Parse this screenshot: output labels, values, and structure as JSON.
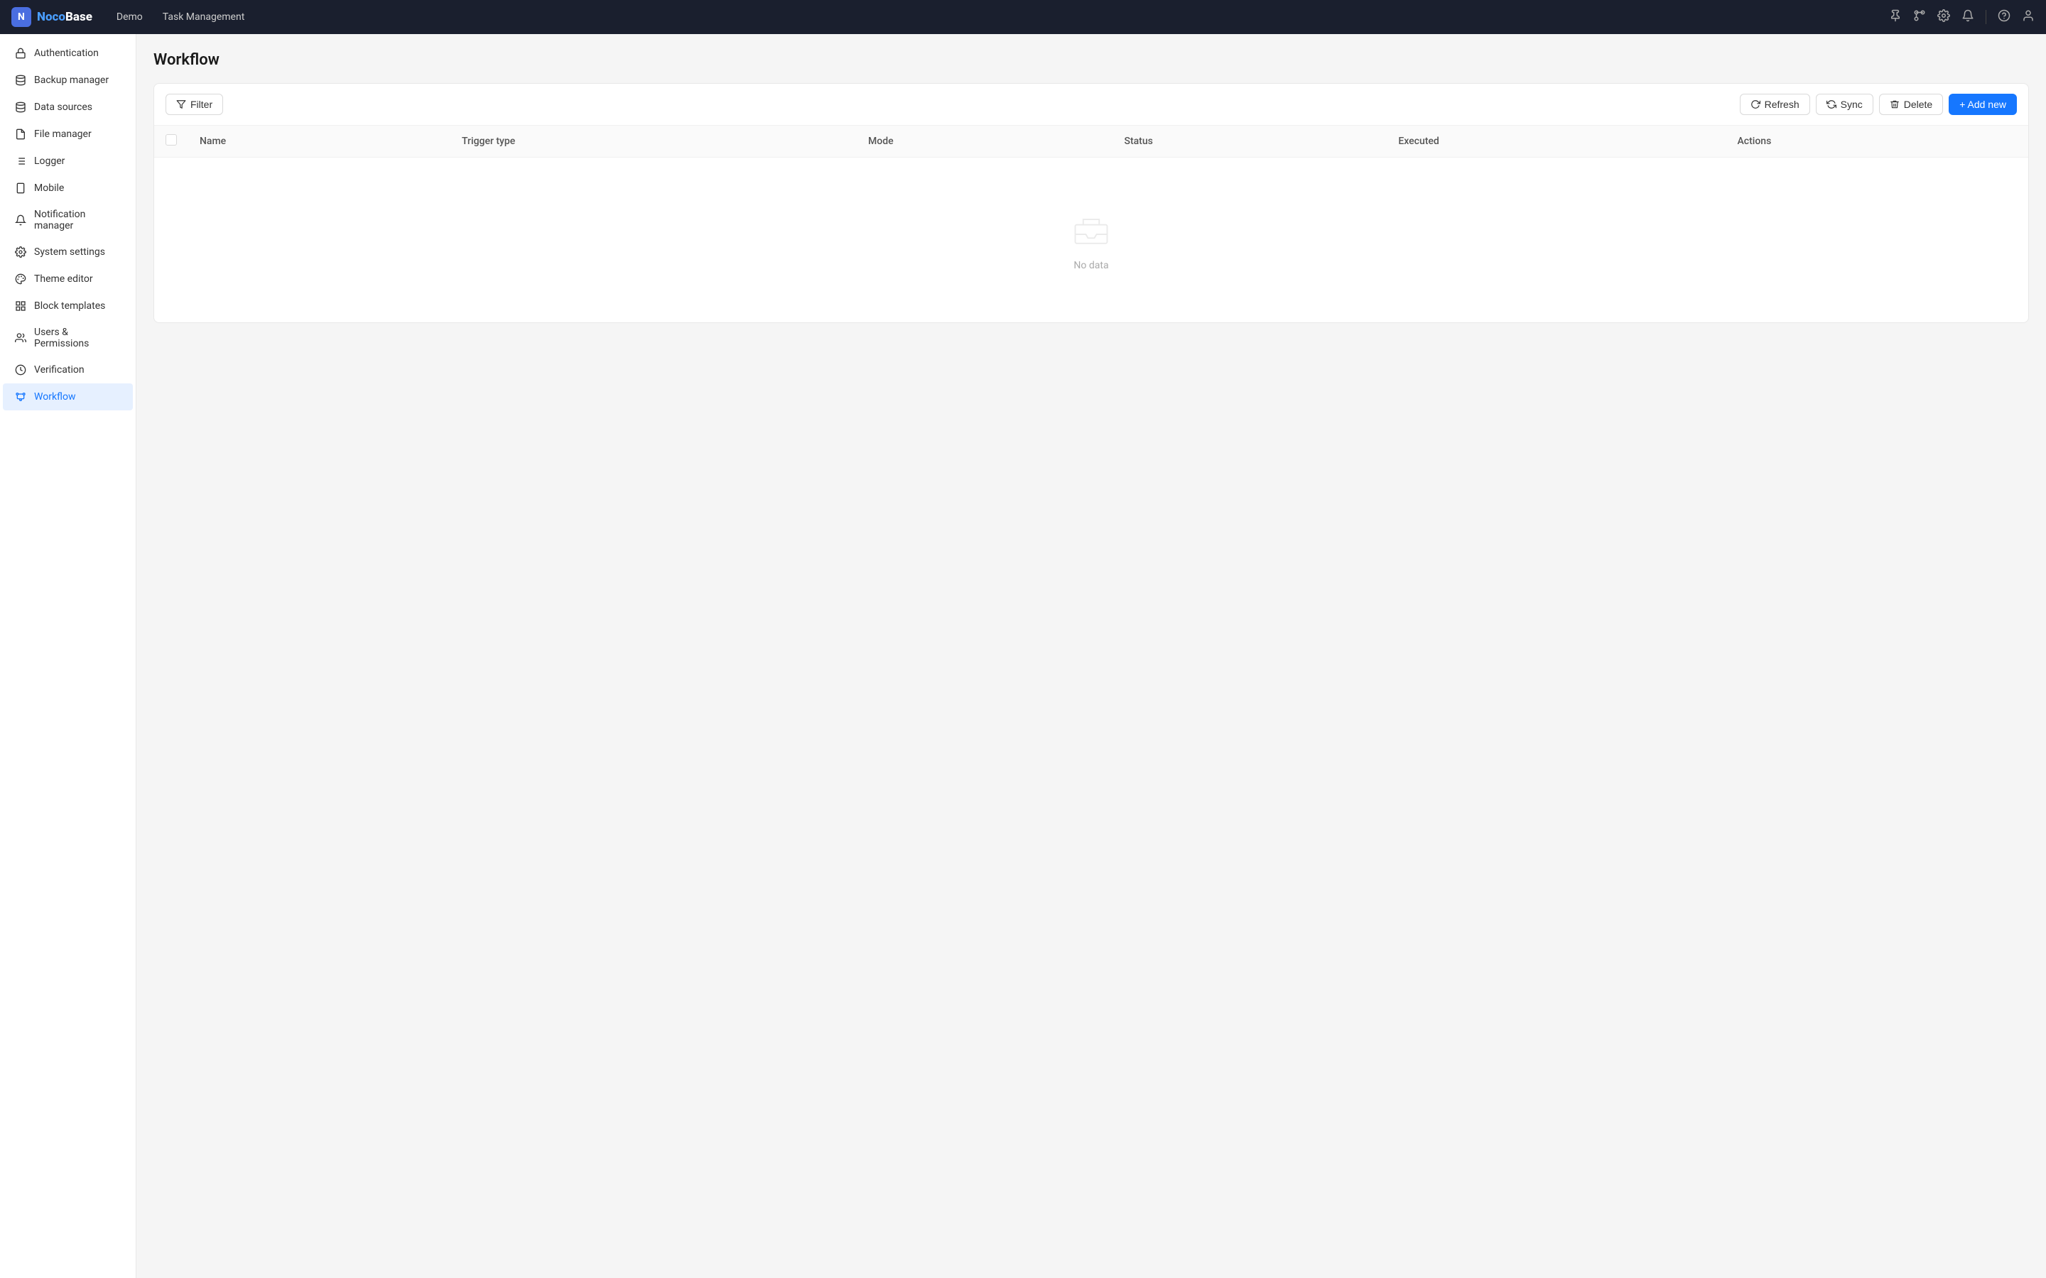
{
  "app": {
    "logo": "NocoBase",
    "logo_highlight": "Noco"
  },
  "topnav": {
    "links": [
      {
        "label": "Demo",
        "id": "demo"
      },
      {
        "label": "Task Management",
        "id": "task-management"
      }
    ],
    "icons": [
      {
        "name": "pin-icon",
        "symbol": "📌"
      },
      {
        "name": "connection-icon",
        "symbol": "🔗"
      },
      {
        "name": "settings-icon",
        "symbol": "⚙"
      },
      {
        "name": "bell-icon",
        "symbol": "🔔"
      },
      {
        "name": "help-icon",
        "symbol": "?"
      },
      {
        "name": "user-icon",
        "symbol": "👤"
      }
    ]
  },
  "sidebar": {
    "items": [
      {
        "id": "authentication",
        "label": "Authentication",
        "icon": "🔑"
      },
      {
        "id": "backup-manager",
        "label": "Backup manager",
        "icon": "💾"
      },
      {
        "id": "data-sources",
        "label": "Data sources",
        "icon": "🗄"
      },
      {
        "id": "file-manager",
        "label": "File manager",
        "icon": "📄"
      },
      {
        "id": "logger",
        "label": "Logger",
        "icon": "📋"
      },
      {
        "id": "mobile",
        "label": "Mobile",
        "icon": "📱"
      },
      {
        "id": "notification-manager",
        "label": "Notification manager",
        "icon": "🔔"
      },
      {
        "id": "system-settings",
        "label": "System settings",
        "icon": "⚙"
      },
      {
        "id": "theme-editor",
        "label": "Theme editor",
        "icon": "🎨"
      },
      {
        "id": "block-templates",
        "label": "Block templates",
        "icon": "🧩"
      },
      {
        "id": "users-permissions",
        "label": "Users & Permissions",
        "icon": "👥"
      },
      {
        "id": "verification",
        "label": "Verification",
        "icon": "✅"
      },
      {
        "id": "workflow",
        "label": "Workflow",
        "icon": "⚡",
        "active": true
      }
    ]
  },
  "page": {
    "title": "Workflow"
  },
  "toolbar": {
    "filter_label": "Filter",
    "refresh_label": "Refresh",
    "sync_label": "Sync",
    "delete_label": "Delete",
    "add_new_label": "+ Add new"
  },
  "table": {
    "columns": [
      {
        "id": "name",
        "label": "Name"
      },
      {
        "id": "trigger-type",
        "label": "Trigger type"
      },
      {
        "id": "mode",
        "label": "Mode"
      },
      {
        "id": "status",
        "label": "Status"
      },
      {
        "id": "executed",
        "label": "Executed"
      },
      {
        "id": "actions",
        "label": "Actions"
      }
    ],
    "rows": [],
    "empty_text": "No data"
  }
}
